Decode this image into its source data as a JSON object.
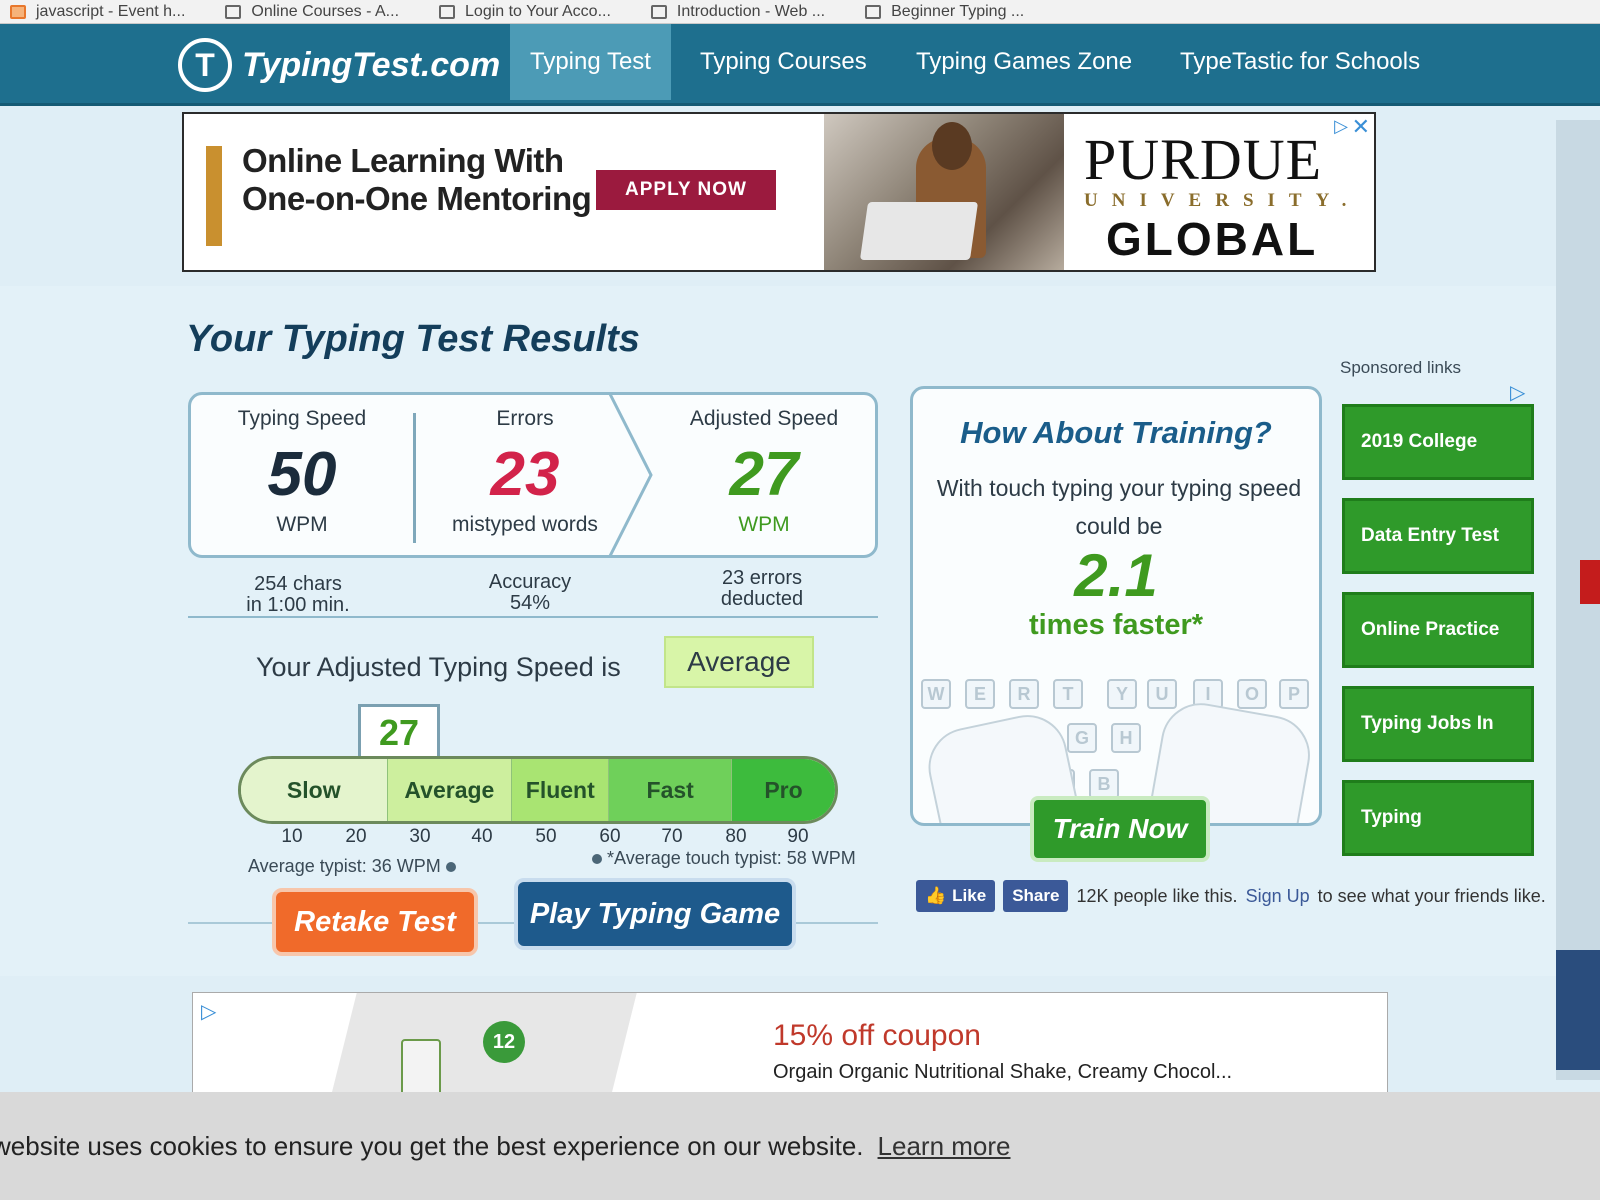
{
  "browser": {
    "bookmarks": [
      "javascript - Event h...",
      "Online Courses - A...",
      "Login to Your Acco...",
      "Introduction - Web ...",
      "Beginner Typing ..."
    ]
  },
  "nav": {
    "logo_text": "TypingTest.com",
    "logo_icon": "typingtest-logo-icon",
    "tabs": [
      "Typing Test",
      "Typing Courses",
      "Typing Games Zone",
      "TypeTastic for Schools"
    ],
    "active_tab": "Typing Test"
  },
  "top_ad": {
    "headline_line1": "Online Learning With",
    "headline_line2": "One-on-One Mentoring",
    "cta": "APPLY NOW",
    "brand_line1": "PURDUE",
    "brand_line2": "UNIVERSITY.",
    "brand_line3": "GLOBAL",
    "adchoices_icon": "▷",
    "close_icon": "✕"
  },
  "results": {
    "title": "Your Typing Test Results",
    "typing_speed": {
      "label": "Typing Speed",
      "value": "50",
      "unit": "WPM",
      "detail_line1": "254 chars",
      "detail_line2": "in 1:00 min."
    },
    "errors": {
      "label": "Errors",
      "value": "23",
      "unit": "mistyped words",
      "detail_line1": "Accuracy",
      "detail_line2": "54%"
    },
    "adjusted_speed": {
      "label": "Adjusted Speed",
      "value": "27",
      "unit": "WPM",
      "detail_line1": "23 errors",
      "detail_line2": "deducted"
    },
    "adjusted_line": "Your Adjusted Typing Speed is",
    "level": "Average",
    "score_marker": "27",
    "scale": {
      "segments": [
        "Slow",
        "Average",
        "Fluent",
        "Fast",
        "Pro"
      ],
      "ticks": [
        "10",
        "20",
        "30",
        "40",
        "50",
        "60",
        "70",
        "80",
        "90"
      ],
      "average_typist": "Average typist: 36 WPM",
      "touch_typist": "*Average touch typist: 58 WPM"
    },
    "buttons": {
      "retake": "Retake Test",
      "game": "Play Typing Game"
    }
  },
  "training": {
    "title": "How About Training?",
    "text": "With touch typing your typing speed could be",
    "multiplier": "2.1",
    "faster": "times faster*",
    "keys_top": [
      "W",
      "E",
      "R",
      "T",
      "Y",
      "U",
      "I",
      "O",
      "P"
    ],
    "keys_mid": [
      "G",
      "H"
    ],
    "keys_bottom": [
      "V",
      "B"
    ],
    "cta": "Train Now"
  },
  "social": {
    "like": "Like",
    "share": "Share",
    "text": "12K people like this.",
    "signup": "Sign Up",
    "after": "to see what your friends like."
  },
  "sponsored": {
    "label": "Sponsored links",
    "links": [
      "2019 College",
      "Data Entry Test",
      "Online Practice",
      "Typing Jobs In",
      "Typing"
    ]
  },
  "bottom_ad": {
    "title": "15% off coupon",
    "description": "Orgain Organic Nutritional Shake, Creamy Chocol...",
    "pack_badge": "12"
  },
  "cookie": {
    "text": "website uses cookies to ensure you get the best experience on our website.",
    "link": "Learn more"
  },
  "colors": {
    "nav_bg": "#1e6f8e",
    "errors_red": "#d2234a",
    "adjusted_green": "#3f9a1f",
    "retake_orange": "#f06a2a",
    "game_blue": "#1e5a8c",
    "sponsored_green": "#2f9a2a"
  }
}
